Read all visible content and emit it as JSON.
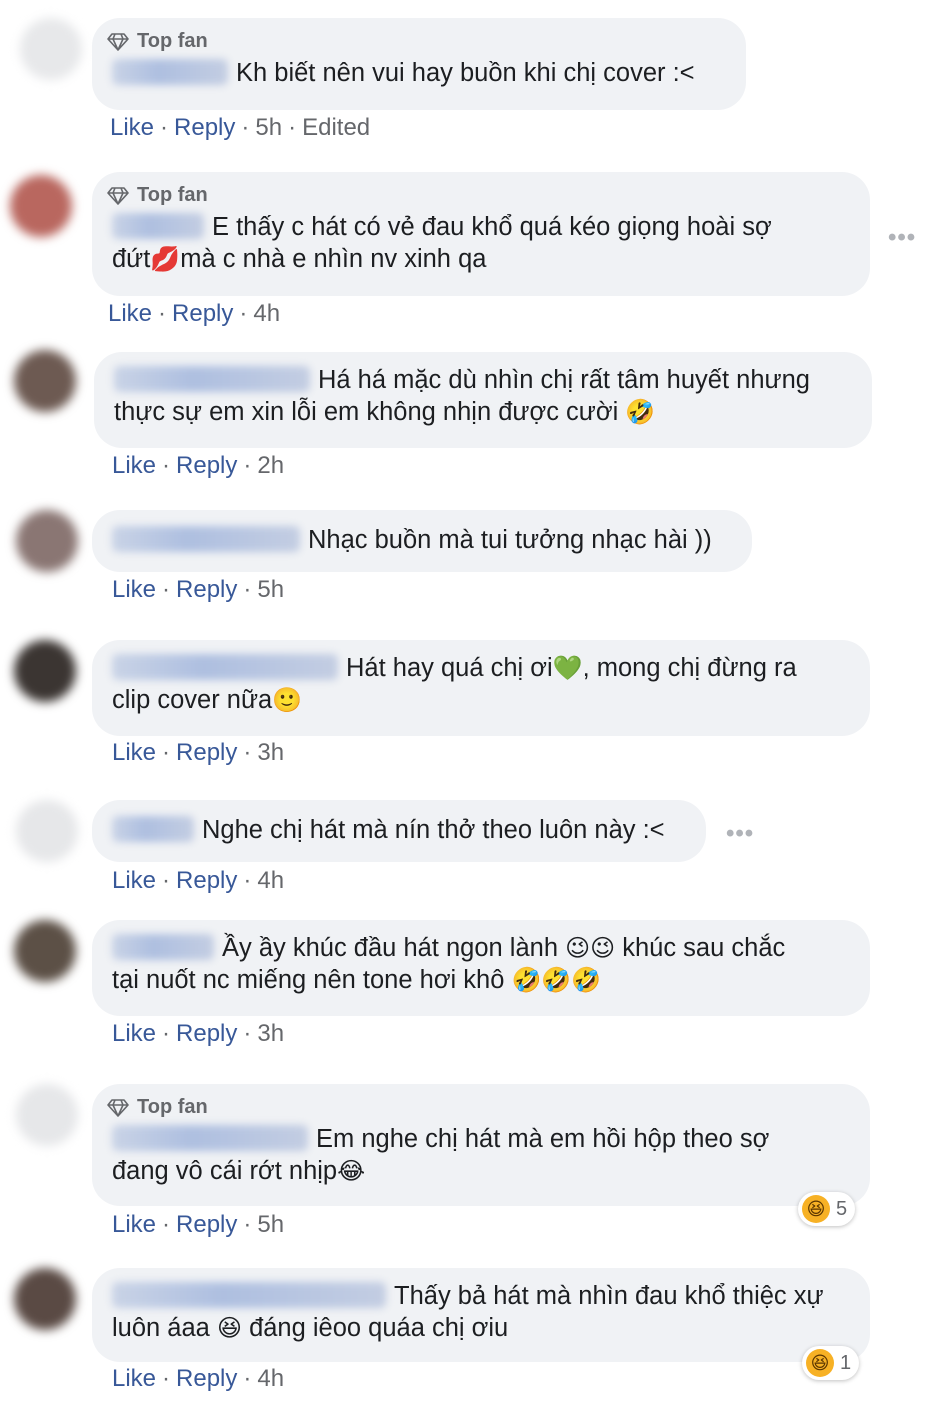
{
  "labels": {
    "like": "Like",
    "reply": "Reply",
    "top_fan": "Top fan",
    "more": "•••",
    "separator": "·"
  },
  "comments": [
    {
      "top_fan": true,
      "text": "Kh biết nên vui hay buồn khi chị cover :<",
      "time": "5h",
      "edited": "Edited"
    },
    {
      "top_fan": true,
      "text_a": "E thấy c hát có vẻ đau khổ quá kéo giọng hoài sợ",
      "text_b": "đứt",
      "emoji": "💋",
      "text_c": "mà c nhà e nhìn nv xinh qa",
      "time": "4h"
    },
    {
      "top_fan": false,
      "text_a": "Há há mặc dù nhìn chị rất tâm huyết nhưng",
      "text_b": "thực sự em xin lỗi em không nhịn được cười",
      "emoji": "🤣",
      "time": "2h"
    },
    {
      "top_fan": false,
      "text": "Nhạc buồn mà tui tưởng nhạc hài ))",
      "time": "5h"
    },
    {
      "top_fan": false,
      "text_a": "Hát hay quá chị ơi",
      "emoji_a": "💚",
      "text_b": ", mong chị đừng ra",
      "text_c": "clip cover nữa",
      "emoji_b": "🙂",
      "time": "3h"
    },
    {
      "top_fan": false,
      "text": "Nghe chị hát mà nín thở theo luôn này :<",
      "time": "4h"
    },
    {
      "top_fan": false,
      "text_a": "Ầy ầy khúc đầu hát ngon lành",
      "emoji_a": "😉😉",
      "text_b": "khúc sau chắc",
      "text_c": "tại nuốt nc miếng nên tone hơi khô",
      "emoji_b": "🤣🤣🤣",
      "time": "3h"
    },
    {
      "top_fan": true,
      "text_a": "Em nghe chị hát mà em hồi hộp theo sợ",
      "text_b": "đang vô cái rớt nhịp",
      "emoji": "😂",
      "time": "5h",
      "reaction_emoji": "😆",
      "reaction_count": "5"
    },
    {
      "top_fan": false,
      "text_a": "Thấy bả hát mà nhìn đau khổ thiệc xự",
      "text_b": "luôn áaa",
      "emoji": "😆",
      "text_c": "đáng iêoo quáa chị ơiu",
      "time": "4h",
      "reaction_emoji": "😆",
      "reaction_count": "1"
    }
  ],
  "colors": {
    "link": "#385898",
    "bubble": "#f0f2f5",
    "meta": "#65676b"
  }
}
